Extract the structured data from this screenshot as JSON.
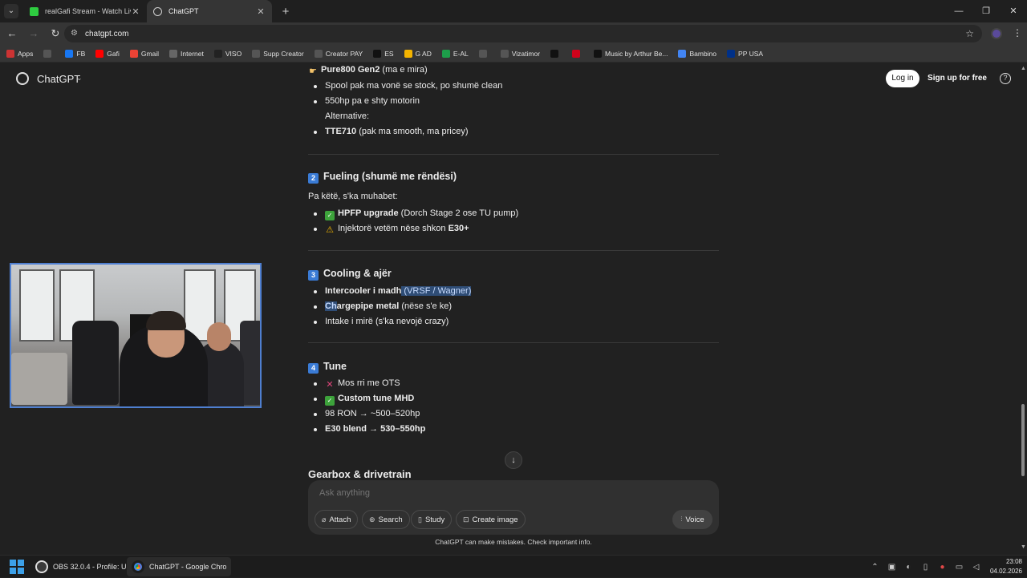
{
  "browser": {
    "tabs": [
      {
        "title": "realGafi Stream - Watch Live on",
        "favicon_color": "#2ecc40"
      },
      {
        "title": "ChatGPT",
        "favicon_color": "#d0d0d0"
      }
    ],
    "url": "chatgpt.com",
    "bookmarks": [
      {
        "label": "Apps",
        "color": "#cc3333"
      },
      {
        "label": "",
        "color": "#555"
      },
      {
        "label": "FB",
        "color": "#1877f2"
      },
      {
        "label": "Gafi",
        "color": "#ff0000"
      },
      {
        "label": "Gmail",
        "color": "#ea4335"
      },
      {
        "label": "Internet",
        "color": "#666"
      },
      {
        "label": "VISO",
        "color": "#222"
      },
      {
        "label": "Supp Creator",
        "color": "#555"
      },
      {
        "label": "Creator PAY",
        "color": "#555"
      },
      {
        "label": "ES",
        "color": "#111"
      },
      {
        "label": "G AD",
        "color": "#f4b400"
      },
      {
        "label": "E-AL",
        "color": "#1d9e4a"
      },
      {
        "label": "",
        "color": "#555"
      },
      {
        "label": "Vizatimor",
        "color": "#555"
      },
      {
        "label": "",
        "color": "#111"
      },
      {
        "label": "",
        "color": "#d0021b"
      },
      {
        "label": "Music by Arthur Be...",
        "color": "#111"
      },
      {
        "label": "Bambino",
        "color": "#4285f4"
      },
      {
        "label": "PP USA",
        "color": "#003087"
      }
    ]
  },
  "header": {
    "title": "ChatGPT",
    "login": "Log in",
    "signup": "Sign up for free",
    "help": "?"
  },
  "conversation": {
    "top_item": {
      "bold": "Pure800 Gen2",
      "rest": " (ma e mira)"
    },
    "turbo_list": [
      "Spool pak ma vonë se stock, po shumë clean",
      "550hp pa e shty motorin"
    ],
    "alternative_label": "Alternative:",
    "alternative_item": {
      "bold": "TTE710",
      "rest": " (pak ma smooth, ma pricey)"
    },
    "fueling": {
      "number": "2",
      "title": "Fueling (shumë me rëndësi)",
      "intro": "Pa këtë, s'ka muhabet:",
      "items": [
        {
          "bold": "HPFP upgrade",
          "rest": " (Dorch Stage 2 ose TU pump)"
        },
        {
          "rest_before": "Injektorë vetëm nëse shkon ",
          "bold": "E30+"
        }
      ]
    },
    "cooling": {
      "number": "3",
      "title": "Cooling & ajër",
      "items": [
        {
          "bold": "Intercooler i madh",
          "highlight": " (VRSF / Wagner)"
        },
        {
          "bold_hl": "Ch",
          "bold": "argepipe metal",
          "rest": " (nëse s'e ke)"
        },
        {
          "rest": "Intake i mirë (s'ka nevojë crazy)"
        }
      ]
    },
    "tune": {
      "number": "4",
      "title": "Tune",
      "items": [
        {
          "rest": "Mos rri me OTS"
        },
        {
          "bold": "Custom tune MHD"
        },
        {
          "rest": "98 RON → ~500–520hp"
        },
        {
          "bold": "E30 blend → 530–550hp"
        }
      ]
    },
    "next_section": "Gearbox & drivetrain"
  },
  "composer": {
    "placeholder": "Ask anything",
    "buttons": [
      "Attach",
      "Search",
      "Study",
      "Create image"
    ],
    "voice": "Voice"
  },
  "disclaimer": "ChatGPT can make mistakes. Check important info.",
  "taskbar": {
    "apps": [
      {
        "label": "OBS 32.0.4 - Profile: Unt",
        "color": "#3a3a3a"
      },
      {
        "label": "ChatGPT - Google Chro",
        "color": "#4285f4"
      }
    ],
    "time": "23:08",
    "date": "04.02.2026"
  }
}
